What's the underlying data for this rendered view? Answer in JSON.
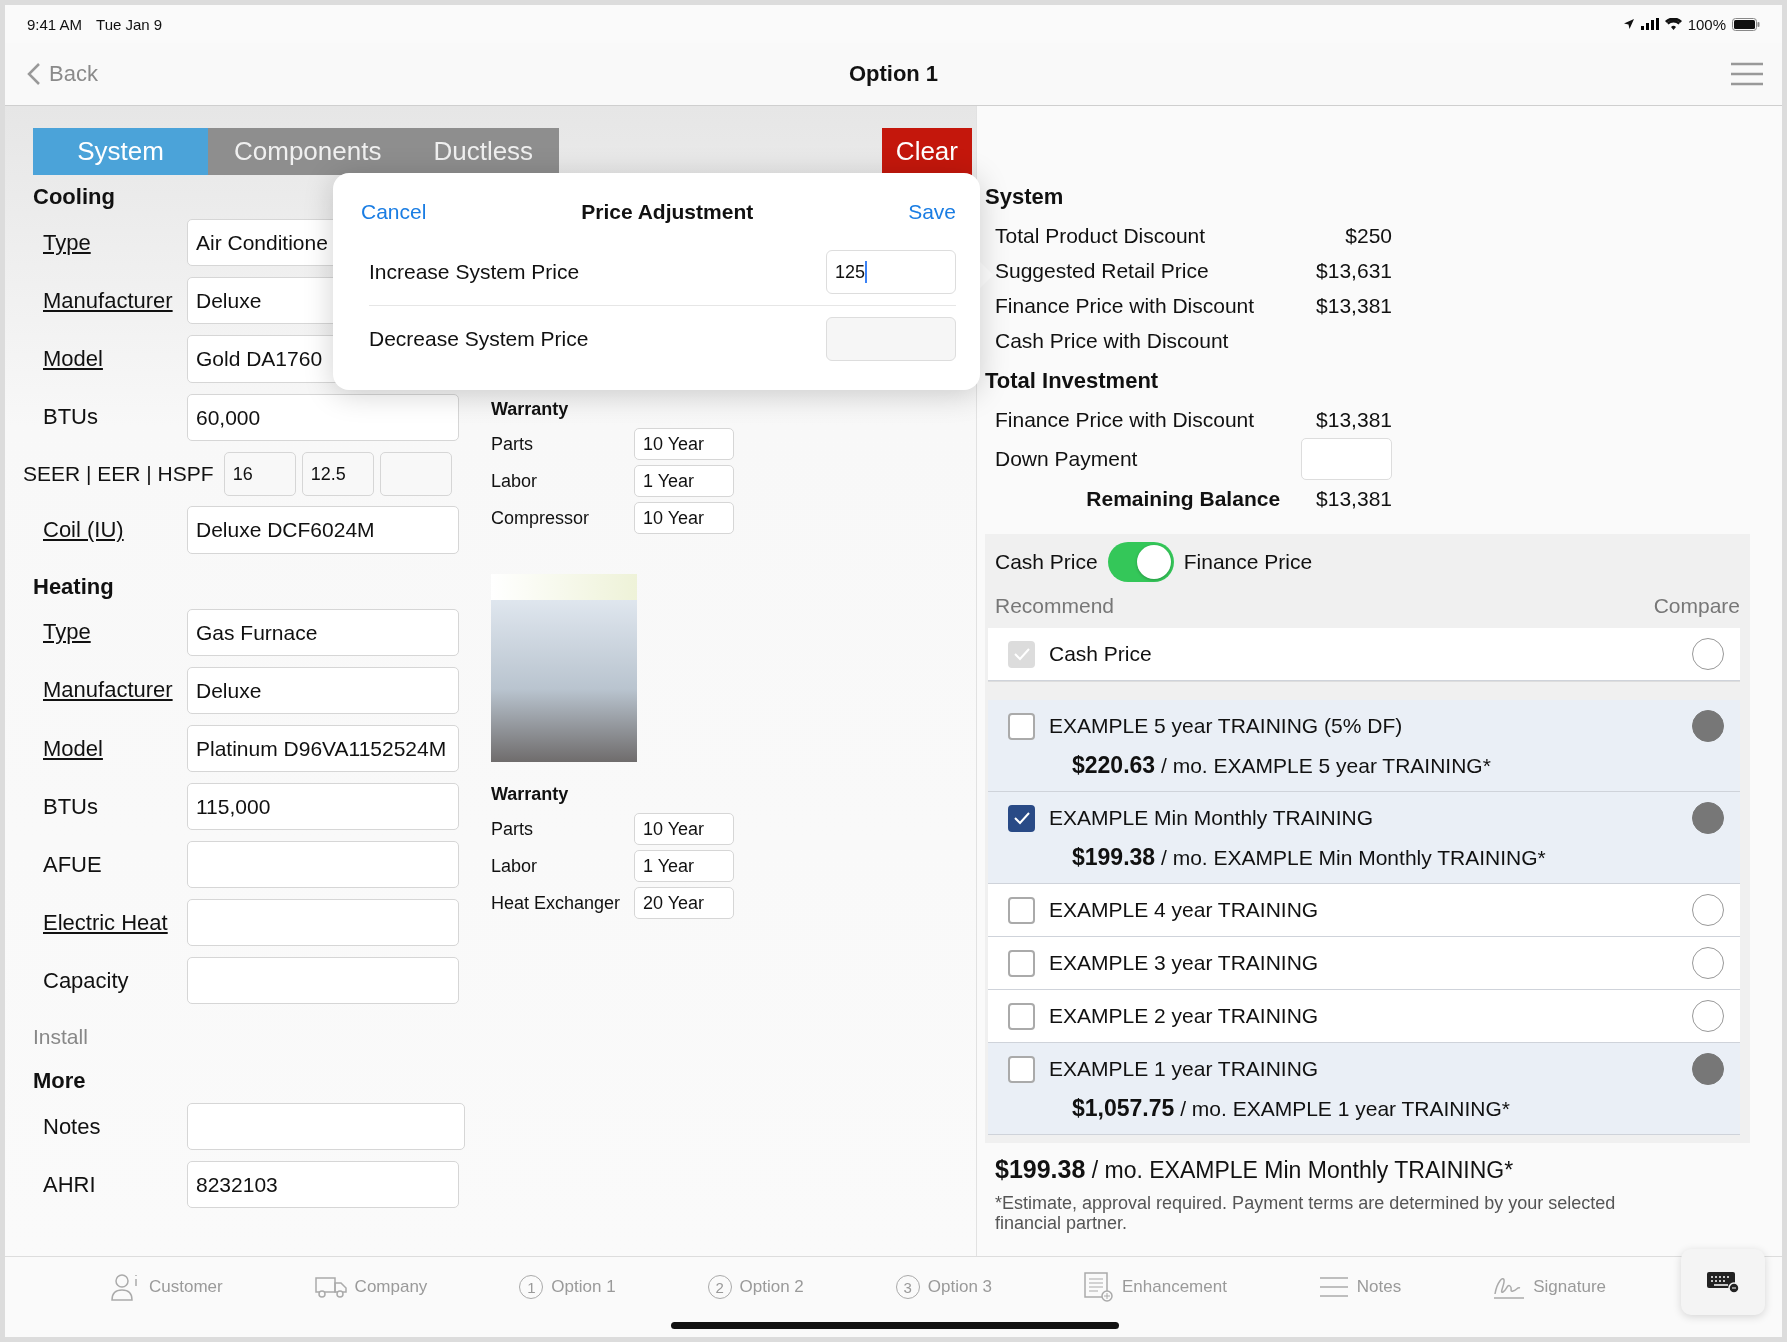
{
  "status_bar": {
    "time": "9:41 AM",
    "date": "Tue Jan 9",
    "battery": "100%"
  },
  "nav": {
    "back": "Back",
    "title": "Option 1"
  },
  "tabs": [
    {
      "label": "System",
      "selected": true
    },
    {
      "label": "Components",
      "selected": false
    },
    {
      "label": "Ductless",
      "selected": false
    }
  ],
  "clear_button": "Clear",
  "sections": [
    {
      "heading": "Cooling",
      "fields": [
        {
          "kind": "text",
          "label": "Type",
          "link": true,
          "value": "Air Conditione"
        },
        {
          "kind": "text",
          "label": "Manufacturer",
          "link": true,
          "value": "Deluxe"
        },
        {
          "kind": "text",
          "label": "Model",
          "link": true,
          "value": "Gold DA1760"
        },
        {
          "kind": "text",
          "label": "BTUs",
          "link": false,
          "value": "60,000"
        },
        {
          "kind": "split",
          "label": "SEER | EER | HSPF",
          "link": false,
          "values": [
            "16",
            "12.5"
          ]
        },
        {
          "kind": "text",
          "label": "Coil (IU)",
          "link": true,
          "value": "Deluxe DCF6024M"
        }
      ]
    },
    {
      "heading": "Heating",
      "fields": [
        {
          "kind": "text",
          "label": "Type",
          "link": true,
          "value": "Gas Furnace"
        },
        {
          "kind": "text",
          "label": "Manufacturer",
          "link": true,
          "value": "Deluxe"
        },
        {
          "kind": "text",
          "label": "Model",
          "link": true,
          "value": "Platinum D96VA1152524M"
        },
        {
          "kind": "text",
          "label": "BTUs",
          "link": false,
          "value": "115,000"
        },
        {
          "kind": "text",
          "label": "AFUE",
          "link": false
        },
        {
          "kind": "text",
          "label": "Electric Heat",
          "link": true
        },
        {
          "kind": "text",
          "label": "Capacity",
          "link": false
        }
      ]
    },
    {
      "subheading": "Install"
    },
    {
      "heading": "More",
      "fields": [
        {
          "kind": "wide",
          "label": "Notes",
          "link": false
        },
        {
          "kind": "text",
          "label": "AHRI",
          "link": false,
          "value": "8232103"
        }
      ]
    }
  ],
  "warranties": [
    {
      "heading": "Warranty",
      "rows": [
        {
          "label": "Parts",
          "value": "10 Year"
        },
        {
          "label": "Labor",
          "value": "1 Year"
        },
        {
          "label": "Compressor",
          "value": "10 Year"
        }
      ]
    },
    {
      "heading": "Warranty",
      "rows": [
        {
          "label": "Parts",
          "value": "10 Year"
        },
        {
          "label": "Labor",
          "value": "1 Year"
        },
        {
          "label": "Heat Exchanger",
          "value": "20 Year"
        }
      ]
    }
  ],
  "popup": {
    "cancel": "Cancel",
    "title": "Price Adjustment",
    "save": "Save",
    "fields": [
      {
        "label": "Increase System Price",
        "value": "125",
        "focused": true
      },
      {
        "label": "Decrease System Price",
        "focused": false
      }
    ]
  },
  "summary": {
    "heading": "System",
    "rows": [
      {
        "label": "Total Product Discount",
        "value": "$250"
      },
      {
        "label": "Suggested Retail Price",
        "value": "$13,631"
      },
      {
        "label": "Finance Price with Discount",
        "value": "$13,381"
      },
      {
        "label": "Cash Price with Discount"
      }
    ],
    "total_heading": "Total Investment",
    "total_rows": [
      {
        "kind": "value",
        "label": "Finance Price with Discount",
        "value": "$13,381"
      },
      {
        "kind": "input",
        "label": "Down Payment"
      },
      {
        "kind": "total",
        "label": "Remaining Balance",
        "value": "$13,381"
      }
    ]
  },
  "pricing": {
    "left_label": "Cash Price",
    "finance_on": true,
    "right_label": "Finance Price",
    "recommend_label": "Recommend",
    "compare_label": "Compare",
    "cash_option": {
      "name": "Cash Price",
      "checked": true,
      "disabled": true,
      "compared": false
    },
    "finance_options": [
      {
        "name": "EXAMPLE 5 year TRAINING (5% DF)",
        "checked": false,
        "compared": true,
        "price_text": "**$220.63** / mo. EXAMPLE 5 year TRAINING*"
      },
      {
        "name": "EXAMPLE Min Monthly TRAINING",
        "checked": true,
        "compared": true,
        "price_text": "**$199.38** / mo. EXAMPLE Min Monthly TRAINING*"
      },
      {
        "name": "EXAMPLE 4 year TRAINING",
        "checked": false,
        "compared": false
      },
      {
        "name": "EXAMPLE 3 year TRAINING",
        "checked": false,
        "compared": false
      },
      {
        "name": "EXAMPLE 2 year TRAINING",
        "checked": false,
        "compared": false
      },
      {
        "name": "EXAMPLE 1 year TRAINING",
        "checked": false,
        "compared": true,
        "price_text": "**$1,057.75** / mo. EXAMPLE 1 year TRAINING*"
      }
    ],
    "selection": "**$199.38** / mo. EXAMPLE Min Monthly TRAINING*",
    "footnote": "*Estimate, approval required. Payment terms are determined by your selected financial partner."
  },
  "bottom_tabs": [
    {
      "label": "Customer"
    },
    {
      "label": "Company"
    },
    {
      "label": "Option 1",
      "number": "1"
    },
    {
      "label": "Option 2",
      "number": "2"
    },
    {
      "label": "Option 3",
      "number": "3"
    },
    {
      "label": "Enhancement"
    },
    {
      "label": "Notes"
    },
    {
      "label": "Signature"
    }
  ]
}
